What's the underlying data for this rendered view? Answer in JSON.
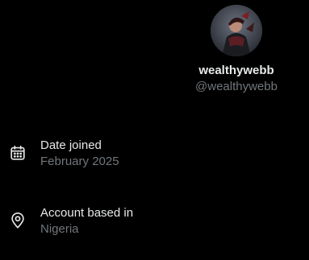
{
  "profile": {
    "display_name": "wealthywebb",
    "handle": "@wealthywebb",
    "avatar_icon": "avatar-image"
  },
  "about": {
    "items": [
      {
        "icon": "calendar-icon",
        "label": "Date joined",
        "value": "February 2025"
      },
      {
        "icon": "location-pin-icon",
        "label": "Account based in",
        "value": "Nigeria"
      }
    ]
  },
  "colors": {
    "background": "#000000",
    "primary_text": "#e7e9ea",
    "secondary_text": "#71767b"
  }
}
